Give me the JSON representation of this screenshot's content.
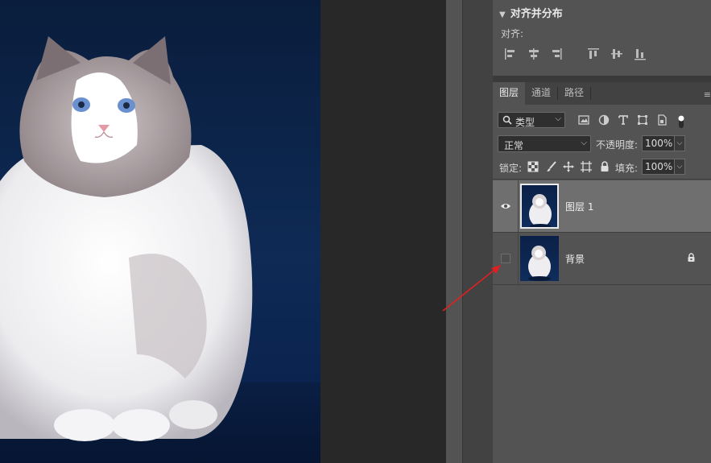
{
  "canvas": {
    "image": "ragdoll-cat-photo"
  },
  "align_panel": {
    "title": "对齐并分布",
    "align_label": "对齐:",
    "align_icons": [
      "align-left-edges-icon",
      "align-horizontal-centers-icon",
      "align-right-edges-icon",
      "align-top-edges-icon",
      "align-vertical-centers-icon",
      "align-bottom-edges-icon"
    ]
  },
  "tabs": [
    {
      "label": "图层",
      "active": true
    },
    {
      "label": "通道",
      "active": false
    },
    {
      "label": "路径",
      "active": false
    }
  ],
  "filter": {
    "kind_label": "类型",
    "icons": [
      "pixel-layer-filter-icon",
      "adjustment-layer-filter-icon",
      "type-layer-filter-icon",
      "shape-layer-filter-icon",
      "smart-object-filter-icon",
      "filter-toggle-icon"
    ]
  },
  "blend": {
    "mode": "正常",
    "opacity_label": "不透明度:",
    "opacity": "100%"
  },
  "lock": {
    "label": "锁定:",
    "icons": [
      "lock-transparent-pixels-icon",
      "lock-image-pixels-icon",
      "lock-position-icon",
      "lock-artboard-icon",
      "lock-all-icon"
    ],
    "fill_label": "填充:",
    "fill": "100%"
  },
  "layers": [
    {
      "name": "图层 1",
      "visible": true,
      "selected": true,
      "locked": false
    },
    {
      "name": "背景",
      "visible": false,
      "selected": false,
      "locked": true
    }
  ],
  "colors": {
    "panel_bg": "#535353",
    "selected_row": "#6f6f6f",
    "annotation_arrow": "#e02020"
  }
}
